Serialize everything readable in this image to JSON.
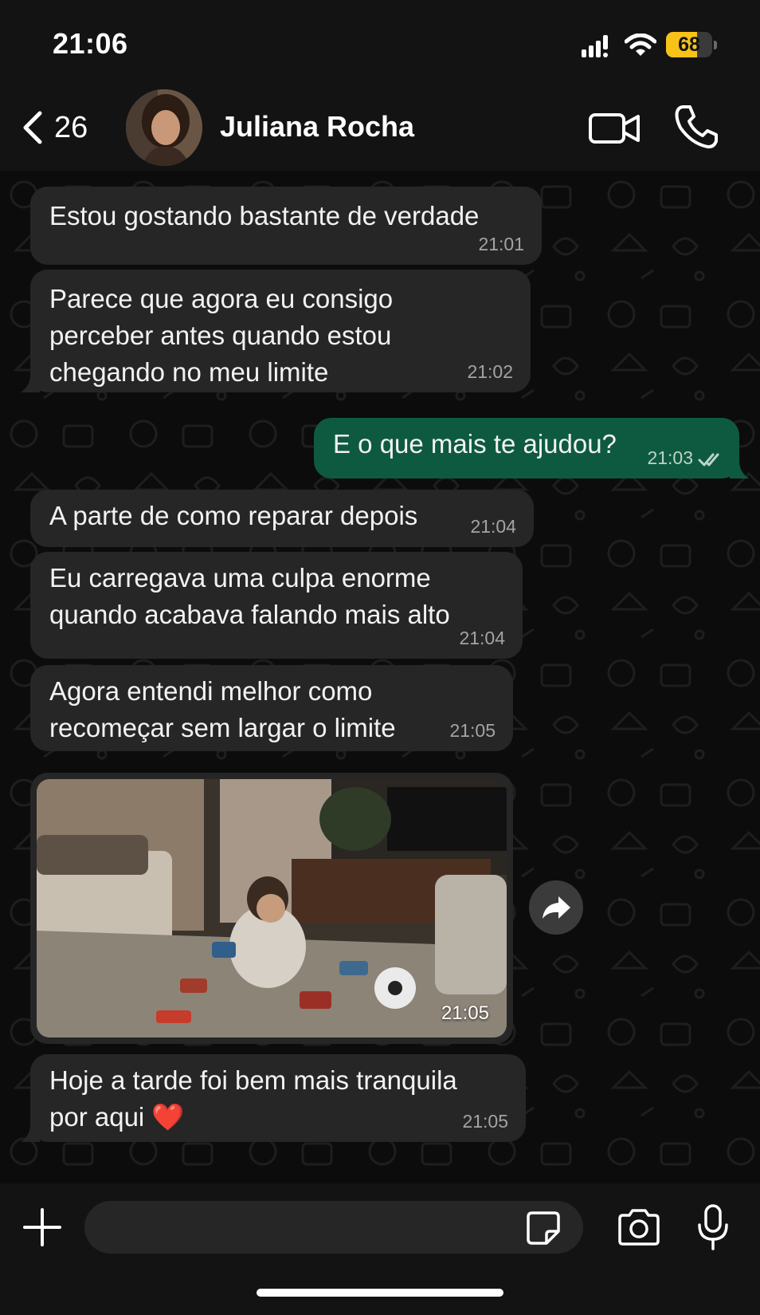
{
  "status_bar": {
    "time": "21:06",
    "battery_level": "68",
    "battery_fraction": 0.68,
    "battery_color": "#f7c318"
  },
  "header": {
    "back_count": "26",
    "contact_name": "Juliana Rocha"
  },
  "messages": [
    {
      "text": "Estou gostando bastante de verdade",
      "time": "21:01"
    },
    {
      "text": "Parece que agora eu consigo\nperceber antes quando estou\nchegando no meu limite",
      "time": "21:02"
    },
    {
      "text": "E o que mais te ajudou?",
      "time": "21:03",
      "read": true
    },
    {
      "text": "A parte de como reparar depois",
      "time": "21:04"
    },
    {
      "text": "Eu carregava uma culpa enorme\nquando acabava falando mais alto",
      "time": "21:04"
    },
    {
      "text": "Agora entendi melhor como\nrecomeçar sem largar o limite",
      "time": "21:05"
    },
    {
      "time": "21:05"
    },
    {
      "text": "Hoje a tarde foi bem mais tranquila\npor aqui ❤️",
      "time": "21:05"
    }
  ],
  "input": {
    "value": "",
    "placeholder": ""
  },
  "colors": {
    "incoming_bubble": "#262626",
    "outgoing_bubble": "#0e5a40",
    "background": "#0c0c0c"
  },
  "icons": [
    "back-chevron-icon",
    "video-camera-icon",
    "phone-icon",
    "double-check-icon",
    "forward-icon",
    "plus-icon",
    "sticker-icon",
    "camera-icon",
    "microphone-icon"
  ]
}
